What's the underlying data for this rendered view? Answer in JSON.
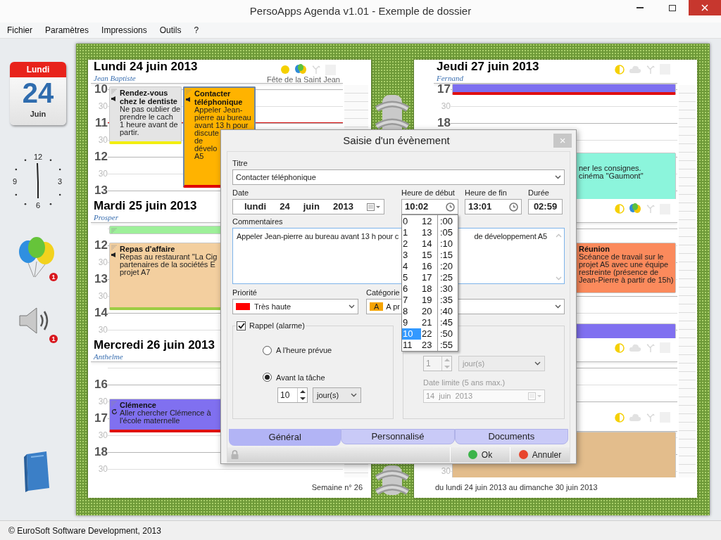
{
  "window": {
    "title": "PersoApps Agenda v1.01 - Exemple de dossier"
  },
  "menu": [
    {
      "label": "Fichier"
    },
    {
      "label": "Paramètres"
    },
    {
      "label": "Impressions"
    },
    {
      "label": "Outils"
    },
    {
      "label": "?"
    }
  ],
  "sidebar": {
    "calendar": {
      "weekday": "Lundi",
      "day": "24",
      "month": "Juin"
    },
    "clock": {
      "numerals": [
        "12",
        "3",
        "6",
        "9"
      ]
    },
    "balloons_badge": "1",
    "sound_badge": "1"
  },
  "left_page": {
    "days": [
      {
        "kind": "weekday",
        "title": "Lundi 24 juin 2013",
        "saint": "Jean Baptiste",
        "feast": "Fête de la Saint Jean",
        "icons": [
          {
            "kind": "sun"
          },
          {
            "kind": "balloons"
          },
          {
            "kind": "sprout"
          },
          {
            "kind": "blank"
          }
        ],
        "slots": [
          "10",
          "30",
          "11",
          "30",
          "12",
          "30",
          "13"
        ],
        "events": [
          {
            "title": "Rendez-vous chez le dentiste",
            "text": "Ne pas oublier de\nprendre le cach\n1 heure avant de\npartir.",
            "color": "#e4e4e4",
            "alarm": true,
            "selected": false
          },
          {
            "title": "Contacter téléphonique",
            "text": "Appeler Jean-\npierre au bureau\navant 13 h pour\ndiscute\nde\ndévelo\nA5",
            "color": "#ffb300",
            "alarm": true,
            "selected": true
          }
        ]
      },
      {
        "kind": "weekday",
        "title": "Mardi 25 juin 2013",
        "saint": "Prosper",
        "slots": [
          "12",
          "30",
          "13",
          "30",
          "14",
          "30"
        ],
        "events": [
          {
            "color": "#9ef09a",
            "selected": false
          },
          {
            "title": "Repas d'affaire",
            "text": "Repas au restaurant \"La Cig\npartenaires de la sociétés E\nprojet A7",
            "color": "#f3cf9f",
            "alarm": true,
            "selected": false
          }
        ]
      },
      {
        "kind": "weekday",
        "title": "Mercredi 26 juin 2013",
        "saint": "Anthelme",
        "slots": [
          "16",
          "30",
          "17",
          "30",
          "18",
          "30"
        ],
        "events": [
          {
            "title": "Clémence",
            "text": "Aller chercher Clémence à\nl'école maternelle",
            "color": "#8070f0",
            "recurring": true,
            "selected": false
          }
        ]
      }
    ],
    "footer": "Semaine n° 26"
  },
  "right_page": {
    "days": [
      {
        "kind": "weekday",
        "title": "Jeudi 27 juin 2013",
        "saint": "Fernand",
        "icons": [
          {
            "kind": "moon"
          },
          {
            "kind": "cloud"
          },
          {
            "kind": "sprout"
          },
          {
            "kind": "blank"
          }
        ],
        "slots": [
          "17",
          "30",
          "18"
        ],
        "events": [
          {
            "color": "#7d6ff0",
            "selected": false
          },
          {
            "text": "ner les consignes.\ncinéma \"Gaumont\"",
            "color": "#8cf5dc",
            "selected": false
          }
        ]
      },
      {
        "kind": "weekday",
        "icons": [
          {
            "kind": "moon"
          },
          {
            "kind": "balloons"
          },
          {
            "kind": "sprout"
          },
          {
            "kind": "blank"
          }
        ],
        "events": [
          {
            "title": "Réunion",
            "text": "Scéance de travail sur le\nprojet A5 avec une équipe\nrestreinte (présence de\nJean-Pierre à partir de 15h)",
            "color": "#fb8a5c",
            "selected": false
          },
          {
            "color": "#8070f0",
            "selected": false
          }
        ]
      },
      {
        "kind": "weekend",
        "icons": [
          {
            "kind": "moon"
          },
          {
            "kind": "cloud"
          },
          {
            "kind": "sprout"
          },
          {
            "kind": "blank"
          }
        ]
      },
      {
        "kind": "weekend",
        "icons": [
          {
            "kind": "moon"
          },
          {
            "kind": "cloud"
          },
          {
            "kind": "sprout"
          },
          {
            "kind": "blank"
          }
        ],
        "slots": [
          "30"
        ],
        "events": [
          {
            "color": "#e3bd8c",
            "selected": false
          }
        ]
      }
    ],
    "footer": "du lundi 24 juin 2013 au dimanche 30 juin 2013"
  },
  "dialog": {
    "title": "Saisie d'un évènement",
    "close": "×",
    "titre": {
      "label": "Titre",
      "value": "Contacter téléphonique"
    },
    "date": {
      "label": "Date",
      "parts": [
        "lundi",
        "24",
        "juin",
        "2013"
      ]
    },
    "start": {
      "label": "Heure de début",
      "value": "10:02"
    },
    "end": {
      "label": "Heure de fin",
      "value": "13:01"
    },
    "duration": {
      "label": "Durée",
      "value": "02:59"
    },
    "comments": {
      "label": "Commentaires",
      "parts": [
        "Appeler Jean-pierre au bureau avant 13 h pour c",
        "de développement A5"
      ]
    },
    "priority": {
      "label": "Priorité",
      "value": "Très haute",
      "color": "#ff0000"
    },
    "category": {
      "label": "Catégorie",
      "badge": "A",
      "value": "A pr",
      "color": "#f5a300"
    },
    "reminder": {
      "label": "Rappel (alarme)",
      "checked": true,
      "options": [
        {
          "label": "A l'heure prévue",
          "selected": false
        },
        {
          "label": "Avant la tâche",
          "selected": true
        }
      ],
      "amount": "10",
      "unit": "jour(s)"
    },
    "recurrence": {
      "disabled": true,
      "amount": "1",
      "unit": "jour(s)",
      "limit_label": "Date limite (5 ans max.)",
      "limit_date": "14  juin  2013"
    },
    "tabs": [
      {
        "label": "Général",
        "selected": true
      },
      {
        "label": "Personnalisé",
        "selected": false
      },
      {
        "label": "Documents",
        "selected": false
      }
    ],
    "buttons": [
      {
        "label": "Ok",
        "color": "#3cb44a"
      },
      {
        "label": "Annuler",
        "color": "#e8452c"
      }
    ],
    "time_picker": {
      "columns": [
        {
          "items": [
            {
              "label": "0",
              "selected": false
            },
            {
              "label": "1",
              "selected": false
            },
            {
              "label": "2",
              "selected": false
            },
            {
              "label": "3",
              "selected": false
            },
            {
              "label": "4",
              "selected": false
            },
            {
              "label": "5",
              "selected": false
            },
            {
              "label": "6",
              "selected": false
            },
            {
              "label": "7",
              "selected": false
            },
            {
              "label": "8",
              "selected": false
            },
            {
              "label": "9",
              "selected": false
            },
            {
              "label": "10",
              "selected": true
            },
            {
              "label": "11",
              "selected": false
            }
          ]
        },
        {
          "items": [
            {
              "label": "12",
              "selected": false
            },
            {
              "label": "13",
              "selected": false
            },
            {
              "label": "14",
              "selected": false
            },
            {
              "label": "15",
              "selected": false
            },
            {
              "label": "16",
              "selected": false
            },
            {
              "label": "17",
              "selected": false
            },
            {
              "label": "18",
              "selected": false
            },
            {
              "label": "19",
              "selected": false
            },
            {
              "label": "20",
              "selected": false
            },
            {
              "label": "21",
              "selected": false
            },
            {
              "label": "22",
              "selected": false
            },
            {
              "label": "23",
              "selected": false
            }
          ]
        },
        {
          "items": [
            {
              "label": ":00",
              "selected": false
            },
            {
              "label": ":05",
              "selected": false
            },
            {
              "label": ":10",
              "selected": false
            },
            {
              "label": ":15",
              "selected": false
            },
            {
              "label": ":20",
              "selected": false
            },
            {
              "label": ":25",
              "selected": false
            },
            {
              "label": ":30",
              "selected": false
            },
            {
              "label": ":35",
              "selected": false
            },
            {
              "label": ":40",
              "selected": false
            },
            {
              "label": ":45",
              "selected": false
            },
            {
              "label": ":50",
              "selected": false
            },
            {
              "label": ":55",
              "selected": false
            }
          ]
        }
      ]
    }
  },
  "status_bar": {
    "text": "© EuroSoft Software Development, 2013"
  }
}
